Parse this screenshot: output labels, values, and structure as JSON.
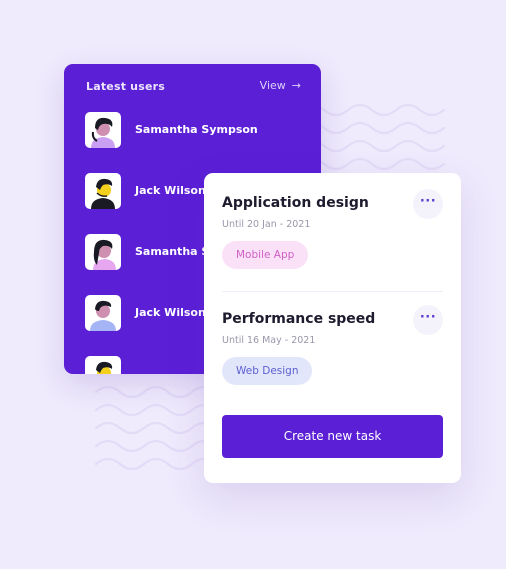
{
  "colors": {
    "background": "#efeafc",
    "accent": "#5b1fd6",
    "card": "#ffffff",
    "tag_pink_bg": "#fbe1f7",
    "tag_pink_text": "#cf5fc6",
    "tag_blue_bg": "#e2e6fb",
    "tag_blue_text": "#5a5fd0"
  },
  "users_panel": {
    "title": "Latest users",
    "view_label": "View",
    "view_icon": "arrow-right-icon",
    "users": [
      {
        "name": "Samantha Sympson",
        "avatar": "woman-avatar"
      },
      {
        "name": "Jack Wilson",
        "avatar": "man-avatar"
      },
      {
        "name": "Samantha Sympson",
        "avatar": "woman-avatar"
      },
      {
        "name": "Jack Wilson",
        "avatar": "man-avatar"
      },
      {
        "name": "",
        "avatar": "man-avatar"
      }
    ]
  },
  "tasks_panel": {
    "tasks": [
      {
        "title": "Application design",
        "due": "Until 20 Jan - 2021",
        "tag": "Mobile App",
        "menu_icon": "more-dots-icon"
      },
      {
        "title": "Performance speed",
        "due": "Until 16 May - 2021",
        "tag": "Web Design",
        "menu_icon": "more-dots-icon"
      }
    ],
    "create_button": "Create new task"
  }
}
